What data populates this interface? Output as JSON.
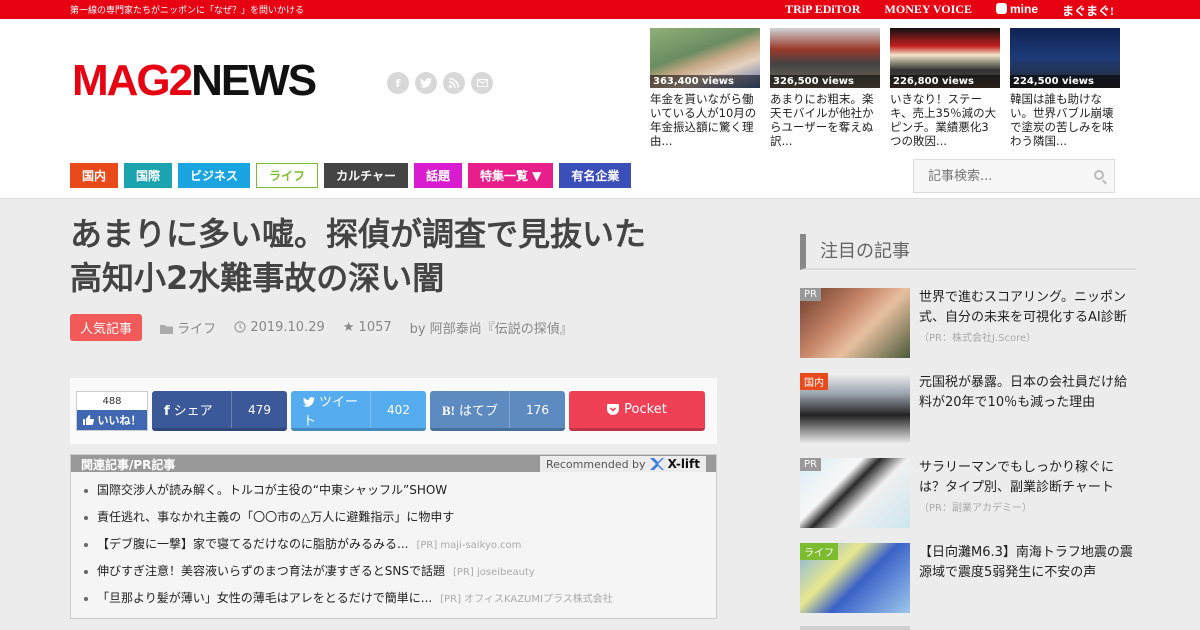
{
  "topbar": {
    "tagline": "第一線の専門家たちがニッポンに「なぜ？」を問いかける",
    "partners": [
      "TRiP EDiTOR",
      "MONEY VOICE",
      "mine",
      "まぐまぐ!"
    ]
  },
  "logo": {
    "mag": "MAG2",
    "news": "NEWS"
  },
  "social_icons": [
    "facebook-icon",
    "twitter-icon",
    "rss-icon",
    "mail-icon"
  ],
  "featured": [
    {
      "views": "363,400 views",
      "title": "年金を貰いながら働いている人が10月の年金振込額に驚く理由..."
    },
    {
      "views": "326,500 views",
      "title": "あまりにお粗末。楽天モバイルが他社からユーザーを奪えぬ訳..."
    },
    {
      "views": "226,800 views",
      "title": "いきなり！ステーキ、売上35％減の大ピンチ。業績悪化3つの敗因..."
    },
    {
      "views": "224,500 views",
      "title": "韓国は誰も助けない。世界バブル崩壊で塗炭の苦しみを味わう隣国..."
    }
  ],
  "nav": [
    {
      "label": "国内",
      "color": "#e84a1b"
    },
    {
      "label": "国際",
      "color": "#1ba3b0"
    },
    {
      "label": "ビジネス",
      "color": "#1aa5e0"
    },
    {
      "label": "ライフ",
      "color": "#7cbc2e"
    },
    {
      "label": "カルチャー",
      "color": "#444444"
    },
    {
      "label": "話題",
      "color": "#d91ccf"
    },
    {
      "label": "特集一覧 ▼",
      "color": "#e81e8a"
    },
    {
      "label": "有名企業",
      "color": "#3c4fb8"
    }
  ],
  "search": {
    "placeholder": "記事検索..."
  },
  "article": {
    "title_line1": "あまりに多い嘘。探偵が調査で見抜いた",
    "title_line2": "高知小2水難事故の深い闇",
    "badge": "人気記事",
    "category": "ライフ",
    "date": "2019.10.29",
    "stars": "1057",
    "author": "by 阿部泰尚『伝説の探偵』"
  },
  "share": {
    "like_count": "488",
    "like_label": "いいね！",
    "facebook_label": "シェア",
    "facebook_count": "479",
    "twitter_label": "ツイート",
    "twitter_count": "402",
    "hatena_label": "はてブ",
    "hatena_count": "176",
    "pocket_label": "Pocket"
  },
  "related": {
    "heading": "関連記事/PR記事",
    "recommended": "Recommended by",
    "brand": "X-lift",
    "items": [
      {
        "text": "国際交渉人が読み解く。トルコが主役の“中東シャッフル”SHOW",
        "pr": ""
      },
      {
        "text": "責任逃れ、事なかれ主義の「〇〇市の△万人に避難指示」に物申す",
        "pr": ""
      },
      {
        "text": "【デブ腹に一撃】家で寝てるだけなのに脂肪がみるみる...",
        "pr": "[PR] maji-saikyo.com"
      },
      {
        "text": "伸びすぎ注意！美容液いらずのまつ育法が凄すぎるとSNSで話題",
        "pr": "[PR] joseibeauty"
      },
      {
        "text": "「旦那より髪が薄い」女性の薄毛はアレをとるだけで簡単に...",
        "pr": "[PR] オフィスKAZUMIプラス株式会社"
      }
    ]
  },
  "sidebar": {
    "heading": "注目の記事",
    "items": [
      {
        "tag": "PR",
        "tag_color": "#999999",
        "title": "世界で進むスコアリング。ニッポン式、自分の未来を可視化するAI診断",
        "pr": "（PR：株式会社J.Score）"
      },
      {
        "tag": "国内",
        "tag_color": "#e84a1b",
        "title": "元国税が暴露。日本の会社員だけ給料が20年で10％も減った理由",
        "pr": ""
      },
      {
        "tag": "PR",
        "tag_color": "#999999",
        "title": "サラリーマンでもしっかり稼ぐには？タイプ別、副業診断チャート",
        "pr": "（PR：副業アカデミー）"
      },
      {
        "tag": "ライフ",
        "tag_color": "#7cbc2e",
        "title": "【日向灘M6.3】南海トラフ地震の震源域で震度5弱発生に不安の声",
        "pr": ""
      }
    ]
  }
}
